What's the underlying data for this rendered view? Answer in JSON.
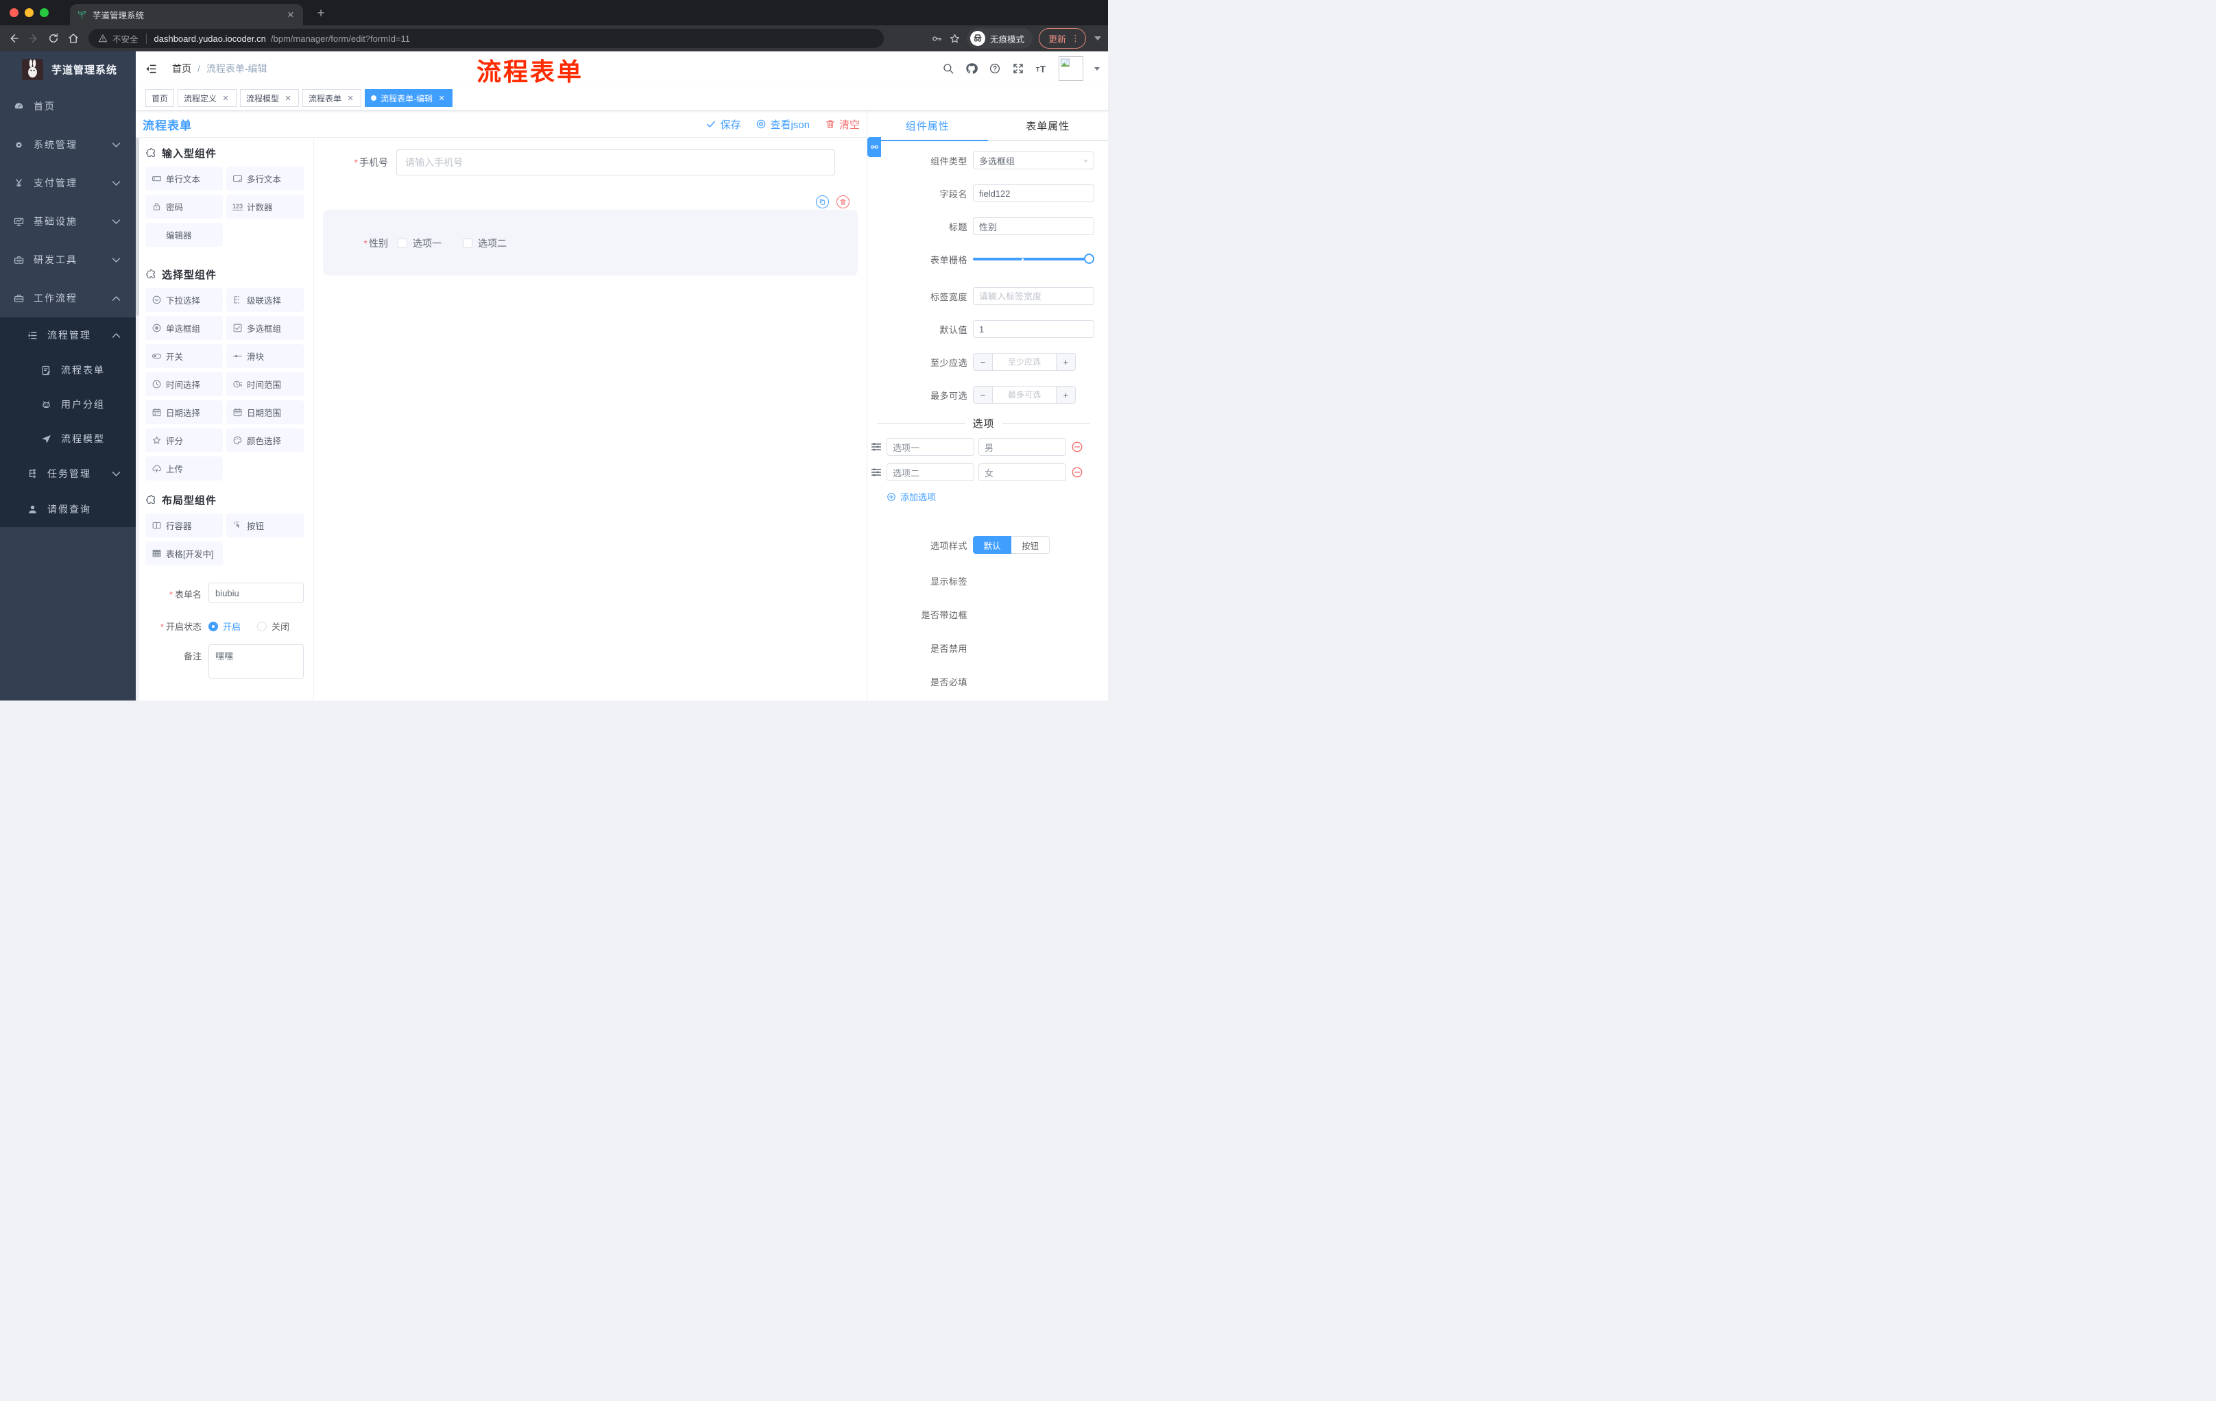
{
  "browser": {
    "tab_title": "芋道管理系统",
    "security_label": "不安全",
    "url_domain": "dashboard.yudao.iocoder.cn",
    "url_path": "/bpm/manager/form/edit?formId=11",
    "incognito_label": "无痕模式",
    "update_label": "更新"
  },
  "sidebar": {
    "logo_title": "芋道管理系统",
    "items": [
      {
        "label": "首页",
        "icon": "dashboard-icon",
        "level": 1
      },
      {
        "label": "系统管理",
        "icon": "gear-icon",
        "level": 1,
        "arrow": "down"
      },
      {
        "label": "支付管理",
        "icon": "yen-icon",
        "level": 1,
        "arrow": "down"
      },
      {
        "label": "基础设施",
        "icon": "monitor-icon",
        "level": 1,
        "arrow": "down"
      },
      {
        "label": "研发工具",
        "icon": "toolbox-icon",
        "level": 1,
        "arrow": "down"
      },
      {
        "label": "工作流程",
        "icon": "briefcase-icon",
        "level": 1,
        "arrow": "up"
      },
      {
        "label": "流程管理",
        "icon": "flow-list-icon",
        "level": 2,
        "arrow": "up",
        "dark": true
      },
      {
        "label": "流程表单",
        "icon": "form-edit-icon",
        "level": 3,
        "dark": true,
        "active": true
      },
      {
        "label": "用户分组",
        "icon": "user-group-icon",
        "level": 3,
        "dark": true
      },
      {
        "label": "流程模型",
        "icon": "paper-plane-icon",
        "level": 3,
        "dark": true
      },
      {
        "label": "任务管理",
        "icon": "task-tree-icon",
        "level": 2,
        "arrow": "down",
        "dark": true
      },
      {
        "label": "请假查询",
        "icon": "person-icon",
        "level": 2,
        "dark": true
      }
    ]
  },
  "header": {
    "breadcrumb_home": "首页",
    "breadcrumb_separator": "/",
    "breadcrumb_current": "流程表单-编辑",
    "annotation": "流程表单",
    "annotation_color": "#ff2b00",
    "icons": [
      "search-icon",
      "github-icon",
      "help-icon",
      "fullscreen-icon",
      "font-size-icon"
    ]
  },
  "tags": {
    "items": [
      {
        "label": "首页",
        "closable": false,
        "active": false
      },
      {
        "label": "流程定义",
        "closable": true,
        "active": false
      },
      {
        "label": "流程模型",
        "closable": true,
        "active": false
      },
      {
        "label": "流程表单",
        "closable": true,
        "active": false
      },
      {
        "label": "流程表单-编辑",
        "closable": true,
        "active": true
      }
    ]
  },
  "designer": {
    "title": "流程表单",
    "save_label": "保存",
    "view_json_label": "查看json",
    "clear_label": "清空"
  },
  "components_panel": {
    "sections": [
      {
        "title": "输入型组件",
        "icon": "puzzle-icon",
        "items": [
          {
            "label": "单行文本",
            "icon": "input-field-icon"
          },
          {
            "label": "多行文本",
            "icon": "textarea-icon"
          },
          {
            "label": "密码",
            "icon": "password-icon"
          },
          {
            "label": "计数器",
            "icon": "counter-icon"
          },
          {
            "label": "编辑器",
            "icon": "none"
          }
        ]
      },
      {
        "title": "选择型组件",
        "icon": "puzzle-icon",
        "items": [
          {
            "label": "下拉选择",
            "icon": "select-icon"
          },
          {
            "label": "级联选择",
            "icon": "cascader-icon"
          },
          {
            "label": "单选框组",
            "icon": "radio-icon"
          },
          {
            "label": "多选框组",
            "icon": "checkbox-icon"
          },
          {
            "label": "开关",
            "icon": "switch-icon"
          },
          {
            "label": "滑块",
            "icon": "slider-icon"
          },
          {
            "label": "时间选择",
            "icon": "time-icon"
          },
          {
            "label": "时间范围",
            "icon": "time-range-icon"
          },
          {
            "label": "日期选择",
            "icon": "date-icon"
          },
          {
            "label": "日期范围",
            "icon": "date-range-icon"
          },
          {
            "label": "评分",
            "icon": "rate-icon"
          },
          {
            "label": "颜色选择",
            "icon": "color-icon"
          },
          {
            "label": "上传",
            "icon": "upload-icon"
          }
        ]
      },
      {
        "title": "布局型组件",
        "icon": "puzzle-icon",
        "items": [
          {
            "label": "行容器",
            "icon": "row-icon"
          },
          {
            "label": "按钮",
            "icon": "button-click-icon"
          },
          {
            "label": "表格[开发中]",
            "icon": "table-icon"
          }
        ]
      }
    ],
    "form": {
      "name_label": "表单名",
      "name_value": "biubiu",
      "status_label": "开启状态",
      "status_on": "开启",
      "status_off": "关闭",
      "remark_label": "备注",
      "remark_value": "嘿嘿"
    }
  },
  "canvas": {
    "phone_label": "手机号",
    "phone_placeholder": "请输入手机号",
    "gender_label": "性别",
    "gender_options": [
      "选项一",
      "选项二"
    ]
  },
  "inspector": {
    "tab_component": "组件属性",
    "tab_form": "表单属性",
    "component_type_label": "组件类型",
    "component_type_value": "多选框组",
    "field_name_label": "字段名",
    "field_name_value": "field122",
    "title_label": "标题",
    "title_value": "性别",
    "grid_label": "表单栅格",
    "label_width_label": "标签宽度",
    "label_width_placeholder": "请输入标签宽度",
    "default_label": "默认值",
    "default_value": "1",
    "min_label": "至少应选",
    "min_placeholder": "至少应选",
    "max_label": "最多可选",
    "max_placeholder": "最多可选",
    "options_title": "选项",
    "options": [
      {
        "label": "选项一",
        "value": "男"
      },
      {
        "label": "选项二",
        "value": "女"
      }
    ],
    "add_option_label": "添加选项",
    "option_style_label": "选项样式",
    "option_style_choices": [
      "默认",
      "按钮"
    ],
    "option_style_selected": "默认",
    "switches": [
      {
        "label": "显示标签",
        "on": true
      },
      {
        "label": "是否带边框",
        "on": false
      },
      {
        "label": "是否禁用",
        "on": false
      },
      {
        "label": "是否必填",
        "on": true
      }
    ],
    "accent_color": "#409eff"
  }
}
